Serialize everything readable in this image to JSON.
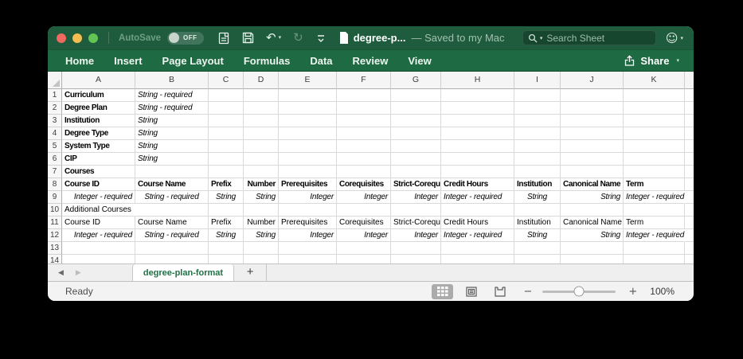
{
  "titlebar": {
    "autosave_label": "AutoSave",
    "autosave_state": "OFF",
    "doc_title": "degree-p...",
    "saved_status": "— Saved to my Mac",
    "search_placeholder": "Search Sheet"
  },
  "ribbon": {
    "tabs": [
      "Home",
      "Insert",
      "Page Layout",
      "Formulas",
      "Data",
      "Review",
      "View"
    ],
    "share_label": "Share"
  },
  "icons": {
    "undo": "↶",
    "redo": "↻",
    "caret": "▾",
    "smiley": "☺",
    "prev_sheet": "◀",
    "next_sheet": "▶",
    "add_sheet": "+",
    "zoom_out": "−",
    "zoom_in": "+"
  },
  "spreadsheet": {
    "columns": [
      "A",
      "B",
      "C",
      "D",
      "E",
      "F",
      "G",
      "H",
      "I",
      "J",
      "K"
    ],
    "rows": [
      {
        "n": "1",
        "cells": {
          "A": {
            "t": "Curriculum",
            "b": 1
          },
          "B": {
            "t": "String - required",
            "i": 1
          }
        }
      },
      {
        "n": "2",
        "cells": {
          "A": {
            "t": "Degree Plan",
            "b": 1
          },
          "B": {
            "t": "String - required",
            "i": 1
          }
        }
      },
      {
        "n": "3",
        "cells": {
          "A": {
            "t": "Institution",
            "b": 1
          },
          "B": {
            "t": "String",
            "i": 1
          }
        }
      },
      {
        "n": "4",
        "cells": {
          "A": {
            "t": "Degree Type",
            "b": 1
          },
          "B": {
            "t": "String",
            "i": 1
          }
        }
      },
      {
        "n": "5",
        "cells": {
          "A": {
            "t": "System Type",
            "b": 1
          },
          "B": {
            "t": "String",
            "i": 1
          }
        }
      },
      {
        "n": "6",
        "cells": {
          "A": {
            "t": "CIP",
            "b": 1
          },
          "B": {
            "t": "String",
            "i": 1
          }
        }
      },
      {
        "n": "7",
        "cells": {
          "A": {
            "t": "Courses",
            "b": 1
          }
        }
      },
      {
        "n": "8",
        "cells": {
          "A": {
            "t": "Course ID",
            "b": 1
          },
          "B": {
            "t": "Course Name",
            "b": 1
          },
          "C": {
            "t": "Prefix",
            "b": 1
          },
          "D": {
            "t": "Number",
            "b": 1,
            "a": "r"
          },
          "E": {
            "t": "Prerequisites",
            "b": 1
          },
          "F": {
            "t": "Corequisites",
            "b": 1
          },
          "G": {
            "t": "Strict-Corequisites",
            "b": 1
          },
          "H": {
            "t": "Credit Hours",
            "b": 1
          },
          "I": {
            "t": "Institution",
            "b": 1
          },
          "J": {
            "t": "Canonical Name",
            "b": 1
          },
          "K": {
            "t": "Term",
            "b": 1
          }
        }
      },
      {
        "n": "9",
        "cells": {
          "A": {
            "t": "Integer - required",
            "i": 1,
            "a": "r"
          },
          "B": {
            "t": "String - required",
            "i": 1,
            "a": "c"
          },
          "C": {
            "t": "String",
            "i": 1,
            "a": "c"
          },
          "D": {
            "t": "String",
            "i": 1,
            "a": "r"
          },
          "E": {
            "t": "Integer",
            "i": 1,
            "a": "r"
          },
          "F": {
            "t": "Integer",
            "i": 1,
            "a": "r"
          },
          "G": {
            "t": "Integer",
            "i": 1,
            "a": "r"
          },
          "H": {
            "t": "Integer - required",
            "i": 1
          },
          "I": {
            "t": "String",
            "i": 1,
            "a": "c"
          },
          "J": {
            "t": "String",
            "i": 1,
            "a": "r"
          },
          "K": {
            "t": "Integer - required",
            "i": 1,
            "o": 1
          }
        }
      },
      {
        "n": "10",
        "cells": {
          "A": {
            "t": "Additional Courses",
            "o": 1
          }
        }
      },
      {
        "n": "11",
        "cells": {
          "A": {
            "t": "Course ID"
          },
          "B": {
            "t": "Course Name"
          },
          "C": {
            "t": "Prefix"
          },
          "D": {
            "t": "Number",
            "a": "r"
          },
          "E": {
            "t": "Prerequisites"
          },
          "F": {
            "t": "Corequisites"
          },
          "G": {
            "t": "Strict-Corequisites"
          },
          "H": {
            "t": "Credit Hours"
          },
          "I": {
            "t": "Institution"
          },
          "J": {
            "t": "Canonical Name"
          },
          "K": {
            "t": "Term"
          }
        }
      },
      {
        "n": "12",
        "cells": {
          "A": {
            "t": "Integer - required",
            "i": 1,
            "a": "r"
          },
          "B": {
            "t": "String - required",
            "i": 1,
            "a": "c"
          },
          "C": {
            "t": "String",
            "i": 1,
            "a": "c"
          },
          "D": {
            "t": "String",
            "i": 1,
            "a": "r"
          },
          "E": {
            "t": "Integer",
            "i": 1,
            "a": "r"
          },
          "F": {
            "t": "Integer",
            "i": 1,
            "a": "r"
          },
          "G": {
            "t": "Integer",
            "i": 1,
            "a": "r"
          },
          "H": {
            "t": "Integer - required",
            "i": 1
          },
          "I": {
            "t": "String",
            "i": 1,
            "a": "c"
          },
          "J": {
            "t": "String",
            "i": 1,
            "a": "r"
          },
          "K": {
            "t": "Integer - required",
            "i": 1,
            "o": 1
          }
        }
      },
      {
        "n": "13",
        "cells": {}
      },
      {
        "n": "14",
        "cells": {},
        "partial": 1
      }
    ]
  },
  "sheet_tabs": {
    "active_tab": "degree-plan-format"
  },
  "status_bar": {
    "status": "Ready",
    "zoom_level": "100%"
  }
}
